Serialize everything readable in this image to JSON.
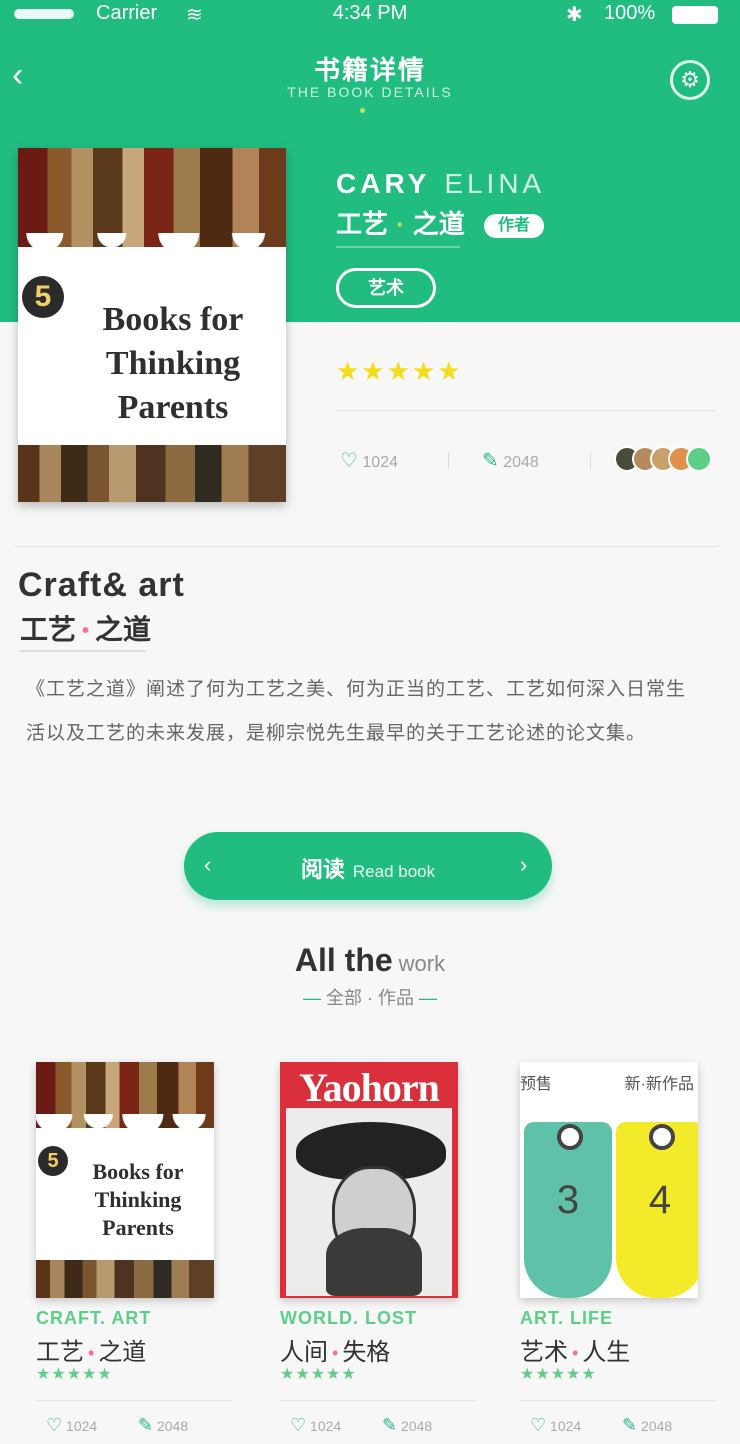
{
  "status_bar": {
    "carrier": "Carrier",
    "wifi_icon": "wifi-icon",
    "time": "4:34 PM",
    "bluetooth_icon": "bluetooth-icon",
    "battery": "100%"
  },
  "nav": {
    "back_icon": "‹",
    "title": "书籍详情",
    "subtitle": "THE BOOK DETAILS",
    "settings_icon": "⚙"
  },
  "book": {
    "cover": {
      "number": "5",
      "title": "Books for Thinking Parents"
    },
    "author_en": "CARY",
    "author_en_2": "ELINA",
    "author_zh_1": "工艺",
    "author_zh_sep": "·",
    "author_zh_2": "之道",
    "author_badge": "作者",
    "category_tag": "艺术",
    "stars": "★★★★★",
    "stats": {
      "likes": "1024",
      "comments": "2048"
    },
    "title_en": "Craft& art",
    "title_zh_1": "工艺",
    "title_zh_sep": "•",
    "title_zh_2": "之道",
    "description": "《工艺之道》阐述了何为工艺之美、何为正当的工艺、工艺如何深入日常生活以及工艺的未来发展，是柳宗悦先生最早的关于工艺论述的论文集。"
  },
  "read_button": {
    "label": "阅读",
    "label_en": "Read book",
    "left_arrow": "‹",
    "right_arrow": "›"
  },
  "section": {
    "title": "All the",
    "title_small": "work",
    "subtitle": "全部 · 作品",
    "dash": "—"
  },
  "works": [
    {
      "number": "5",
      "cover_title": "Books for Thinking Parents",
      "en": "CRAFT. ART",
      "zh_1": "工艺",
      "zh_sep": "•",
      "zh_2": "之道",
      "stars": "★★★★★",
      "likes": "1024",
      "comments": "2048"
    },
    {
      "masthead": "Yaohorn",
      "en": "WORLD. LOST",
      "zh_1": "人间",
      "zh_sep": "•",
      "zh_2": "失格",
      "stars": "★★★★★",
      "likes": "1024",
      "comments": "2048"
    },
    {
      "head_left": "预售",
      "head_right": "新·新作品",
      "tag_1": "3",
      "tag_2": "4",
      "en": "ART. LIFE",
      "zh_1": "艺术",
      "zh_sep": "•",
      "zh_2": "人生",
      "stars": "★★★★★",
      "likes": "1024",
      "comments": "2048"
    }
  ],
  "icons": {
    "like": "♡",
    "comment": "✎"
  },
  "colors": {
    "accent": "#21bd80",
    "star": "#f4dc1a",
    "pink": "#ff6b9a",
    "light_green": "#5dcf88"
  }
}
